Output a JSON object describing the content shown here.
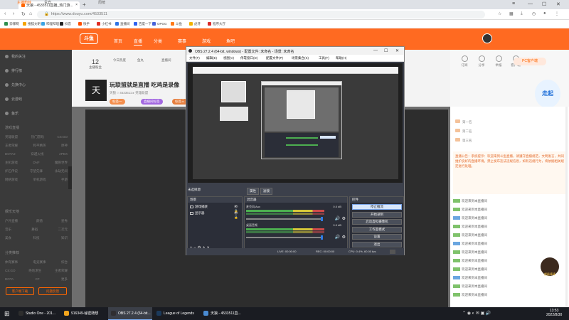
{
  "browser": {
    "tab_title": "天狼 - 4533511直播_热门游...",
    "tab_close": "×",
    "new_tab": "+",
    "win_min": "—",
    "win_max": "☐",
    "win_close": "✕",
    "win_menu": "≡",
    "url": "https://www.douyu.com/4533511",
    "back": "‹",
    "forward": "›",
    "reload": "↻",
    "home": "⌂",
    "bookmarks": [
      {
        "label": "去哪网",
        "color": "#2f8f4e"
      },
      {
        "label": "搜狐文明",
        "color": "#f4a300"
      },
      {
        "label": "哔哩哔哩",
        "color": "#3aa3e3"
      },
      {
        "label": "抖音",
        "color": "#222222"
      },
      {
        "label": "快手",
        "color": "#ff5000"
      },
      {
        "label": "小红书",
        "color": "#e02e24"
      },
      {
        "label": "直播间",
        "color": "#2f74e5"
      },
      {
        "label": "百度一下",
        "color": "#2f63f0"
      },
      {
        "label": "OPGG",
        "color": "#4863d9"
      },
      {
        "label": "斗鱼",
        "color": "#ff7a17"
      },
      {
        "label": "虎牙",
        "color": "#f2b300"
      },
      {
        "label": "程序大厅",
        "color": "#da2a2a"
      }
    ]
  },
  "site": {
    "logo": "斗鱼",
    "nav": [
      "首页",
      "直播",
      "分类",
      "赛事",
      "游戏",
      "鱼吧"
    ],
    "left_nav": [
      "我的关注",
      "排行榜",
      "兑换中心",
      "云游戏",
      "鱼乐"
    ],
    "left_section_title": "游戏直播",
    "left_grid": [
      [
        "英雄联盟",
        "热门游戏",
        "CS:GO"
      ],
      [
        "王者荣耀",
        "和平精英",
        "原神"
      ],
      [
        "DOTA2",
        "穿越火线",
        "APEX"
      ],
      [
        "主机游戏",
        "DNF",
        "魔兽世界"
      ],
      [
        "炉石传说",
        "守望先锋",
        "永劫无间"
      ],
      [
        "网络游戏",
        "单机游戏",
        "手游"
      ]
    ],
    "left_section2_title": "娱乐天地",
    "left_grid2": [
      [
        "户外直播",
        "颜值",
        "星秀"
      ],
      [
        "音乐",
        "舞蹈",
        "二次元"
      ],
      [
        "美食",
        "科技",
        "知识"
      ]
    ],
    "left_section3_title": "分类推荐",
    "left_grid3": [
      [
        "体育赛事",
        "电竞赛事",
        "综合"
      ],
      [
        "CS:GO",
        "绝地求生",
        "王者荣耀"
      ],
      [
        "DOTA",
        "CF",
        "更多"
      ]
    ],
    "left_btn1": "客户端下载",
    "left_btn2": "问题反馈"
  },
  "stream": {
    "stats": [
      {
        "n": "12",
        "l": "主播粉丝"
      },
      {
        "n": "",
        "l": "今日热度"
      },
      {
        "n": "",
        "l": "鱼丸"
      },
      {
        "n": "",
        "l": "直播间"
      },
      {
        "n": "",
        "l": "关注"
      },
      {
        "n": "",
        "l": "分享"
      },
      {
        "n": "",
        "l": "订阅"
      }
    ],
    "avatar_text": "天",
    "title": "玩联盟就是直播 吃鸡是录像",
    "meta": "天狼 ○ 4533511 ▸ 英雄联盟",
    "tags": [
      {
        "label": "标签一",
        "color": "#f58f4d"
      },
      {
        "label": "直播间标签",
        "color": "#a368e0"
      },
      {
        "label": "标签三",
        "color": "#e67f3e"
      }
    ]
  },
  "right": {
    "icons": [
      "订阅",
      "分享",
      "举报",
      "客户端"
    ],
    "pc_btn": "PC客户端",
    "badge": "走起",
    "tabs": [
      "主播粉丝",
      "贵宾",
      "",
      "周榜"
    ],
    "ranks": [
      "第一名",
      "第二名",
      "第三名"
    ],
    "notice": "直播公告：系统提示：欢迎来到斗鱼直播，请遵守直播规范，文明发言，共同维护良好的直播环境。禁止发布违法违规信息，如有违规行为，将依据相关规定进行处理。",
    "chat": [
      {
        "lv": 1,
        "user": "",
        "msg": "欢迎来到本直播间"
      },
      {
        "lv": 1,
        "user": "",
        "msg": "欢迎来到本直播间"
      },
      {
        "lv": 2,
        "user": "",
        "msg": "欢迎来到本直播间"
      },
      {
        "lv": 1,
        "user": "",
        "msg": "欢迎来到本直播间"
      },
      {
        "lv": 1,
        "user": "",
        "msg": "欢迎来到本直播间"
      },
      {
        "lv": 2,
        "user": "",
        "msg": "欢迎来到本直播间"
      },
      {
        "lv": 1,
        "user": "",
        "msg": "欢迎来到本直播间"
      },
      {
        "lv": 1,
        "user": "",
        "msg": "欢迎来到本直播间"
      },
      {
        "lv": 1,
        "user": "",
        "msg": "欢迎来到本直播间"
      },
      {
        "lv": 2,
        "user": "",
        "msg": "欢迎来到本直播间"
      },
      {
        "lv": 1,
        "user": "",
        "msg": "欢迎来到本直播间"
      },
      {
        "lv": 1,
        "user": "",
        "msg": "欢迎来到本直播间"
      }
    ],
    "gift_label": "超级棒棒"
  },
  "obs": {
    "title": "OBS 27.2.4 (64-bit, windows) - 配置文件: 未命名 - 场景: 未命名",
    "menu": [
      "文件(F)",
      "编辑(E)",
      "视图(V)",
      "停靠窗口(D)",
      "配置文件(P)",
      "场景集合(S)",
      "工具(T)",
      "帮助(H)"
    ],
    "scene_label": "未选择源",
    "tabs": [
      "属性",
      "滤镜"
    ],
    "sources_header": "场景",
    "sources": [
      "游戏捕获",
      "显示器"
    ],
    "mixer_header": "混音器",
    "mixer_tracks": [
      {
        "name": "麦克风/Aux",
        "db": "0.0 dB"
      },
      {
        "name": "桌面音频",
        "db": "0.0 dB"
      }
    ],
    "controls_header": "控件",
    "controls": [
      "停止推流",
      "开始录制",
      "启动虚拟摄像机",
      "工作室模式",
      "设置",
      "退出"
    ],
    "status": {
      "live": "LIVE: 00:00:00",
      "rec": "REC: 00:00:00",
      "cpu": "CPU: 0.4%, 60.00 fps"
    }
  },
  "taskbar": {
    "start": "⊞",
    "items": [
      {
        "label": "Studio One - 201...",
        "color": "#2d2d2d"
      },
      {
        "label": "916349-秘密随想",
        "color": "#f2a51d"
      },
      {
        "label": "OBS 27.2.4 (64-bit...",
        "color": "#302e31"
      },
      {
        "label": "League of Legends",
        "color": "#1b3a5c"
      },
      {
        "label": "天狼 - 4533511直...",
        "color": "#4a8bd2"
      }
    ],
    "time": "13:53",
    "date": "2022/8/30"
  }
}
